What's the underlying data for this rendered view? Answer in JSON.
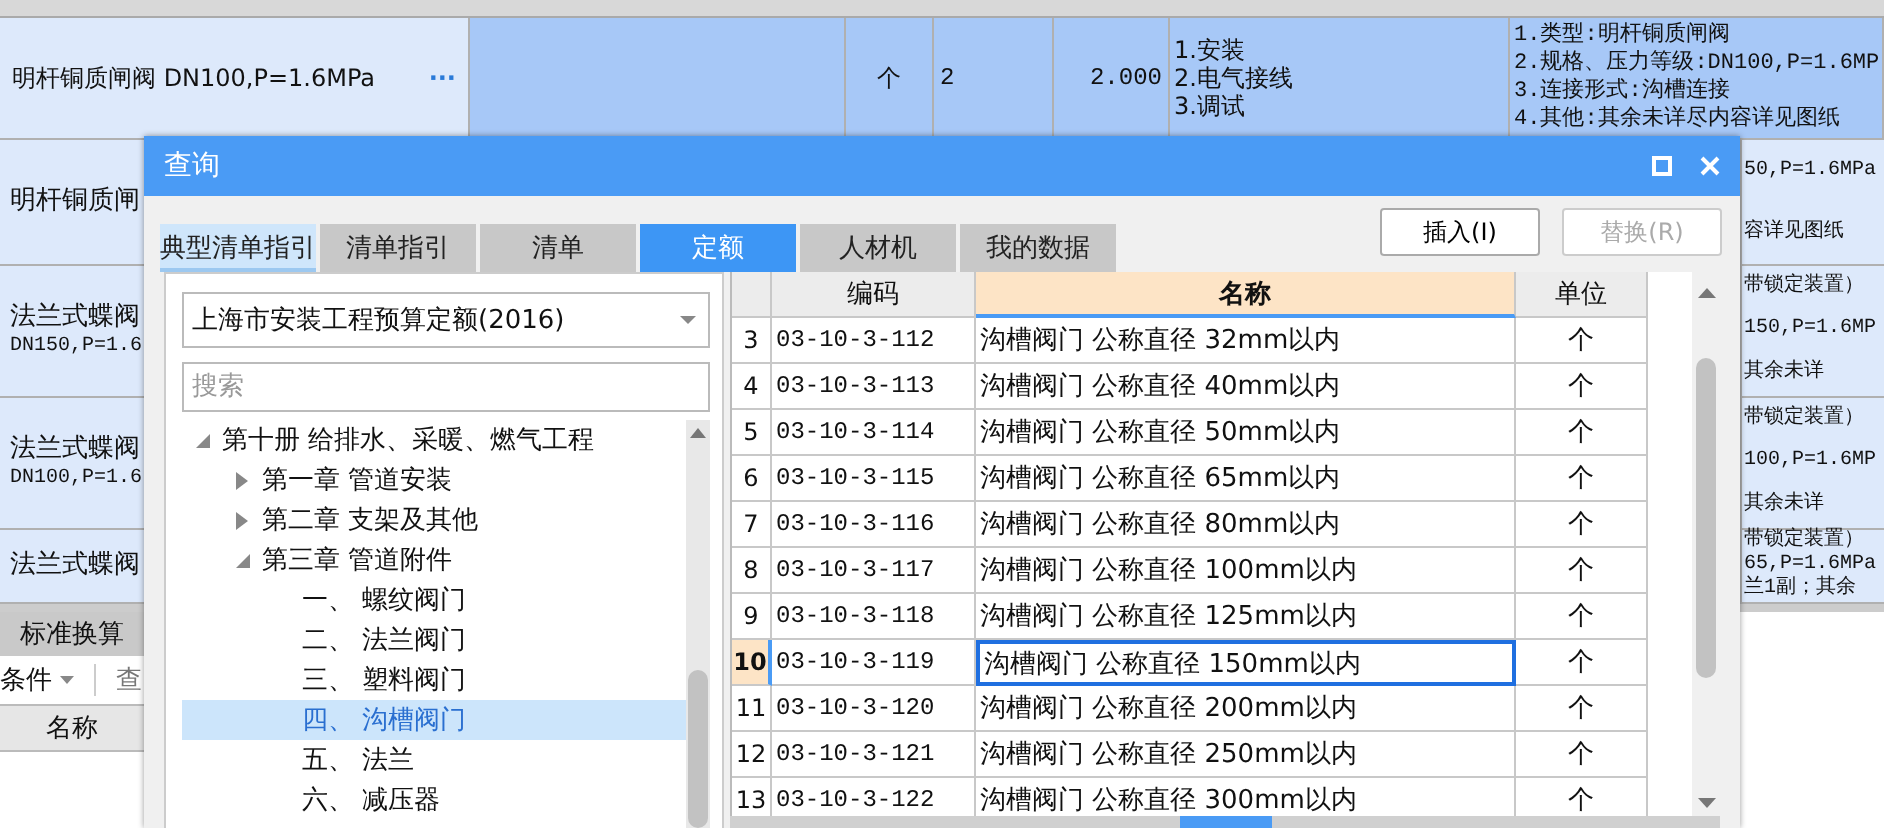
{
  "sheet": {
    "rows": [
      {
        "name": "明杆铜质闸阀 DN100,P=1.6MPa",
        "more": "···",
        "unit": "个",
        "quantity": "2",
        "total": "2.000",
        "work": [
          "1.安装",
          "2.电气接线",
          "3.调试"
        ],
        "features": [
          "1.类型:明杆铜质闸阀",
          "2.规格、压力等级:DN100,P=1.6MP",
          "3.连接形式:沟槽连接",
          "4.其他:其余未详尽内容详见图纸"
        ],
        "selected": true
      }
    ],
    "partial_rows": [
      {
        "left": [
          "明杆铜质闸"
        ],
        "right": [
          "50,P=1.6MPa",
          "容详见图纸"
        ]
      },
      {
        "left": [
          "法兰式蝶阀",
          "DN150,P=1.6"
        ],
        "right": [
          "带锁定装置）",
          "150,P=1.6MP",
          "其余未详"
        ]
      },
      {
        "left": [
          "法兰式蝶阀",
          "DN100,P=1.6"
        ],
        "right": [
          "带锁定装置）",
          "100,P=1.6MP",
          "其余未详"
        ]
      },
      {
        "left": [
          "法兰式蝶阀"
        ],
        "right": [
          "带锁定装置）",
          "65,P=1.6MPa",
          "兰1副；其余"
        ]
      }
    ]
  },
  "bottom_panel": {
    "tab": "标准换算",
    "filter": "条件",
    "query": "查",
    "column": "名称"
  },
  "dialog": {
    "title": "查询",
    "tabs": [
      {
        "label": "典型清单指引",
        "selected": false,
        "highlighted": true
      },
      {
        "label": "清单指引",
        "selected": false,
        "highlighted": false
      },
      {
        "label": "清单",
        "selected": false,
        "highlighted": false
      },
      {
        "label": "定额",
        "selected": true,
        "highlighted": false
      },
      {
        "label": "人材机",
        "selected": false,
        "highlighted": false
      },
      {
        "label": "我的数据",
        "selected": false,
        "highlighted": false
      }
    ],
    "buttons": [
      {
        "label": "插入(I)",
        "disabled": false
      },
      {
        "label": "替换(R)",
        "disabled": true
      }
    ],
    "library": "上海市安装工程预算定额(2016)",
    "search": {
      "placeholder": "搜索"
    },
    "tree": [
      {
        "label": "第十册 给排水、采暖、燃气工程",
        "expanded": true,
        "selected": false,
        "children": [
          {
            "label": "第一章 管道安装",
            "expanded": false,
            "selected": false
          },
          {
            "label": "第二章 支架及其他",
            "expanded": false,
            "selected": false
          },
          {
            "label": "第三章 管道附件",
            "expanded": true,
            "selected": false,
            "children": [
              {
                "label": "一、 螺纹阀门",
                "selected": false
              },
              {
                "label": "二、 法兰阀门",
                "selected": false
              },
              {
                "label": "三、 塑料阀门",
                "selected": false
              },
              {
                "label": "四、 沟槽阀门",
                "selected": true
              },
              {
                "label": "五、 法兰",
                "selected": false
              },
              {
                "label": "六、 减压器",
                "selected": false
              }
            ]
          }
        ]
      }
    ],
    "table": {
      "columns": [
        {
          "label": "编码",
          "selected": false
        },
        {
          "label": "名称",
          "selected": true
        },
        {
          "label": "单位",
          "selected": false
        }
      ],
      "rows": [
        {
          "index": "3",
          "code": "03-10-3-112",
          "name": "沟槽阀门 公称直径 32mm以内",
          "unit": "个",
          "selected": false
        },
        {
          "index": "4",
          "code": "03-10-3-113",
          "name": "沟槽阀门 公称直径 40mm以内",
          "unit": "个",
          "selected": false
        },
        {
          "index": "5",
          "code": "03-10-3-114",
          "name": "沟槽阀门 公称直径 50mm以内",
          "unit": "个",
          "selected": false
        },
        {
          "index": "6",
          "code": "03-10-3-115",
          "name": "沟槽阀门 公称直径 65mm以内",
          "unit": "个",
          "selected": false
        },
        {
          "index": "7",
          "code": "03-10-3-116",
          "name": "沟槽阀门 公称直径 80mm以内",
          "unit": "个",
          "selected": false
        },
        {
          "index": "8",
          "code": "03-10-3-117",
          "name": "沟槽阀门 公称直径 100mm以内",
          "unit": "个",
          "selected": false
        },
        {
          "index": "9",
          "code": "03-10-3-118",
          "name": "沟槽阀门 公称直径 125mm以内",
          "unit": "个",
          "selected": false
        },
        {
          "index": "10",
          "code": "03-10-3-119",
          "name": "沟槽阀门 公称直径 150mm以内",
          "unit": "个",
          "selected": true
        },
        {
          "index": "11",
          "code": "03-10-3-120",
          "name": "沟槽阀门 公称直径 200mm以内",
          "unit": "个",
          "selected": false
        },
        {
          "index": "12",
          "code": "03-10-3-121",
          "name": "沟槽阀门 公称直径 250mm以内",
          "unit": "个",
          "selected": false
        },
        {
          "index": "13",
          "code": "03-10-3-122",
          "name": "沟槽阀门 公称直径 300mm以内",
          "unit": "个",
          "selected": false
        }
      ]
    }
  }
}
